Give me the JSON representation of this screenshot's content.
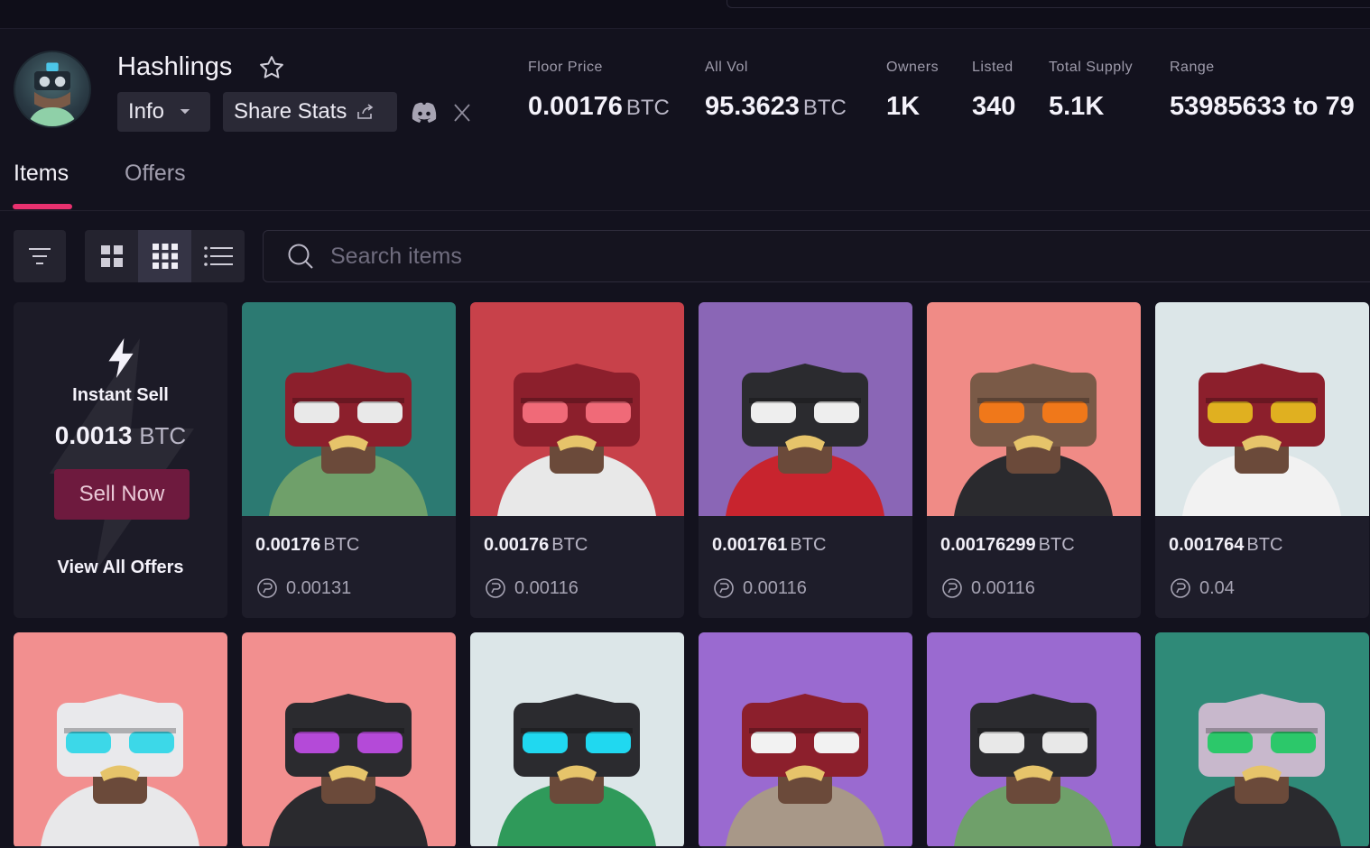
{
  "collection": {
    "name": "Hashlings",
    "info_label": "Info",
    "share_label": "Share Stats"
  },
  "stats": [
    {
      "label": "Floor Price",
      "value": "0.00176",
      "unit": "BTC"
    },
    {
      "label": "All Vol",
      "value": "95.3623",
      "unit": "BTC"
    },
    {
      "label": "Owners",
      "value": "1K",
      "unit": ""
    },
    {
      "label": "Listed",
      "value": "340",
      "unit": ""
    },
    {
      "label": "Total Supply",
      "value": "5.1K",
      "unit": ""
    },
    {
      "label": "Range",
      "value": "53985633 to 79",
      "unit": ""
    }
  ],
  "tabs": [
    {
      "label": "Items",
      "active": true
    },
    {
      "label": "Offers",
      "active": false
    }
  ],
  "search": {
    "placeholder": "Search items"
  },
  "instant_sell": {
    "title": "Instant Sell",
    "amount": "0.0013",
    "unit": "BTC",
    "sell_label": "Sell Now",
    "view_all_label": "View All Offers"
  },
  "items": [
    {
      "price": "0.00176",
      "unit": "BTC",
      "offer": "0.00131",
      "bg": "#2c7a72",
      "head": "#8c1f2c",
      "eye": "#e9e9e9",
      "body": "#6fa06a"
    },
    {
      "price": "0.00176",
      "unit": "BTC",
      "offer": "0.00116",
      "bg": "#c8414a",
      "head": "#8c1f2c",
      "eye": "#f06a78",
      "body": "#e8e8e8"
    },
    {
      "price": "0.001761",
      "unit": "BTC",
      "offer": "0.00116",
      "bg": "#8a66b6",
      "head": "#2b2b2f",
      "eye": "#eeeeee",
      "body": "#c8242e"
    },
    {
      "price": "0.00176299",
      "unit": "BTC",
      "offer": "0.00116",
      "bg": "#f08b86",
      "head": "#7a5a47",
      "eye": "#f0781a",
      "body": "#2a2a2e"
    },
    {
      "price": "0.001764",
      "unit": "BTC",
      "offer": "0.04",
      "bg": "#dce6e8",
      "head": "#8c1f2c",
      "eye": "#e0b020",
      "body": "#f2f2f2"
    },
    {
      "price": "",
      "unit": "",
      "offer": "",
      "bg": "#f28f8f",
      "head": "#e9e9ec",
      "eye": "#3cd8e8",
      "body": "#e8e8ea"
    },
    {
      "price": "",
      "unit": "",
      "offer": "",
      "bg": "#f28f8f",
      "head": "#2b2b2f",
      "eye": "#b44ad8",
      "body": "#2a2a2e"
    },
    {
      "price": "",
      "unit": "",
      "offer": "",
      "bg": "#dce6e8",
      "head": "#2b2b2f",
      "eye": "#20d8f0",
      "body": "#2f9a5a"
    },
    {
      "price": "",
      "unit": "",
      "offer": "",
      "bg": "#9a6ad0",
      "head": "#8c1f2c",
      "eye": "#f2f2f2",
      "body": "#a89888"
    },
    {
      "price": "",
      "unit": "",
      "offer": "",
      "bg": "#9a6ad0",
      "head": "#2b2b2f",
      "eye": "#e8e8e8",
      "body": "#6fa06a"
    },
    {
      "price": "",
      "unit": "",
      "offer": "",
      "bg": "#2f8a78",
      "head": "#c8b8cc",
      "eye": "#2cc86a",
      "body": "#2a2a2e"
    }
  ],
  "colors": {
    "accent": "#e8316f",
    "sell_button": "#6e1a3e"
  }
}
